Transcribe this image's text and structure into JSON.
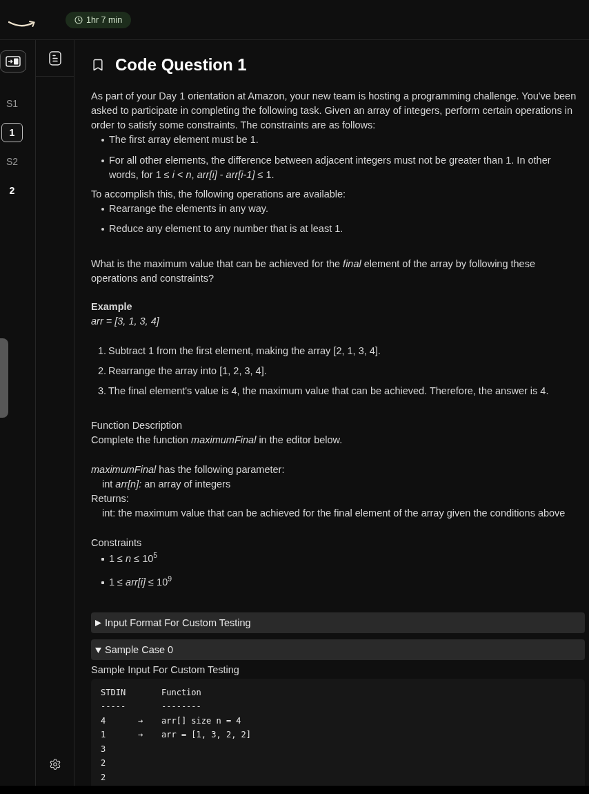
{
  "top_bar": {
    "timer": "1hr 7 min"
  },
  "sidebar": {
    "sections": [
      {
        "label": "S1",
        "questions": [
          {
            "label": "1",
            "selected": true
          }
        ]
      },
      {
        "label": "S2",
        "questions": [
          {
            "label": "2",
            "selected": false
          }
        ]
      }
    ]
  },
  "question": {
    "title": "Code Question 1",
    "intro": {
      "text": "As part of your Day 1 orientation at Amazon, your new team is hosting a programming challenge. You've been asked to participate in completing the following task. Given an array of integers, perform certain operations in order to satisfy some constraints. The constraints are as follows:",
      "bullets": [
        "The first array element must be 1.",
        "For all other elements, the difference between adjacent integers must not be greater than 1. In other words, for 1 ≤ *i* < *n*, *arr[i]* - *arr[i-1]* ≤ 1."
      ]
    },
    "operations": {
      "text": "To accomplish this, the following operations are available:",
      "bullets": [
        "Rearrange the elements in any way.",
        "Reduce any element to any number that is at least 1."
      ]
    },
    "task": "What is the maximum value that can be achieved for the *final* element of the array by following these operations and constraints?",
    "example": {
      "heading": "Example",
      "array": "arr = [3, 1, 3, 4]",
      "steps": [
        {
          "number": "1.",
          "text": "Subtract 1 from the first element, making the array [2, 1, 3, 4]."
        },
        {
          "number": "2.",
          "text": "Rearrange the array into [1, 2, 3, 4]."
        },
        {
          "number": "3.",
          "text": "The final element's value is 4, the maximum value that can be achieved. Therefore, the answer is 4."
        }
      ]
    },
    "function_description": {
      "heading": "Function Description",
      "text": "Complete the function *maximumFinal* in the editor below.",
      "signature": "*maximumFinal* has the following parameter:",
      "parameters": [
        "int *arr[n]:* an array of integers"
      ],
      "returns_label": "Returns:",
      "returns": "int: the maximum value that can be achieved for the final element of the array given the conditions above"
    },
    "constraints": {
      "heading": "Constraints",
      "items": [
        "1 ≤ *n* ≤ 10$^{5}$",
        "1 ≤ *arr[i]* ≤ 10$^{9}$"
      ]
    }
  },
  "accordion": [
    {
      "label": "Input Format For Custom Testing",
      "expanded": false
    },
    {
      "label": "Sample Case 0",
      "expanded": true,
      "content": {
        "label": "Sample Input For Custom Testing",
        "header": [
          "STDIN",
          "Function"
        ],
        "rule": [
          "-----",
          "--------"
        ],
        "rows": [
          {
            "stdin": "4",
            "arrow": "→",
            "function": "arr[] size n = 4"
          },
          {
            "stdin": "1",
            "arrow": "→",
            "function": "arr = [1, 3, 2, 2]"
          },
          {
            "stdin": "3"
          },
          {
            "stdin": "2"
          },
          {
            "stdin": "2"
          }
        ]
      }
    }
  ]
}
